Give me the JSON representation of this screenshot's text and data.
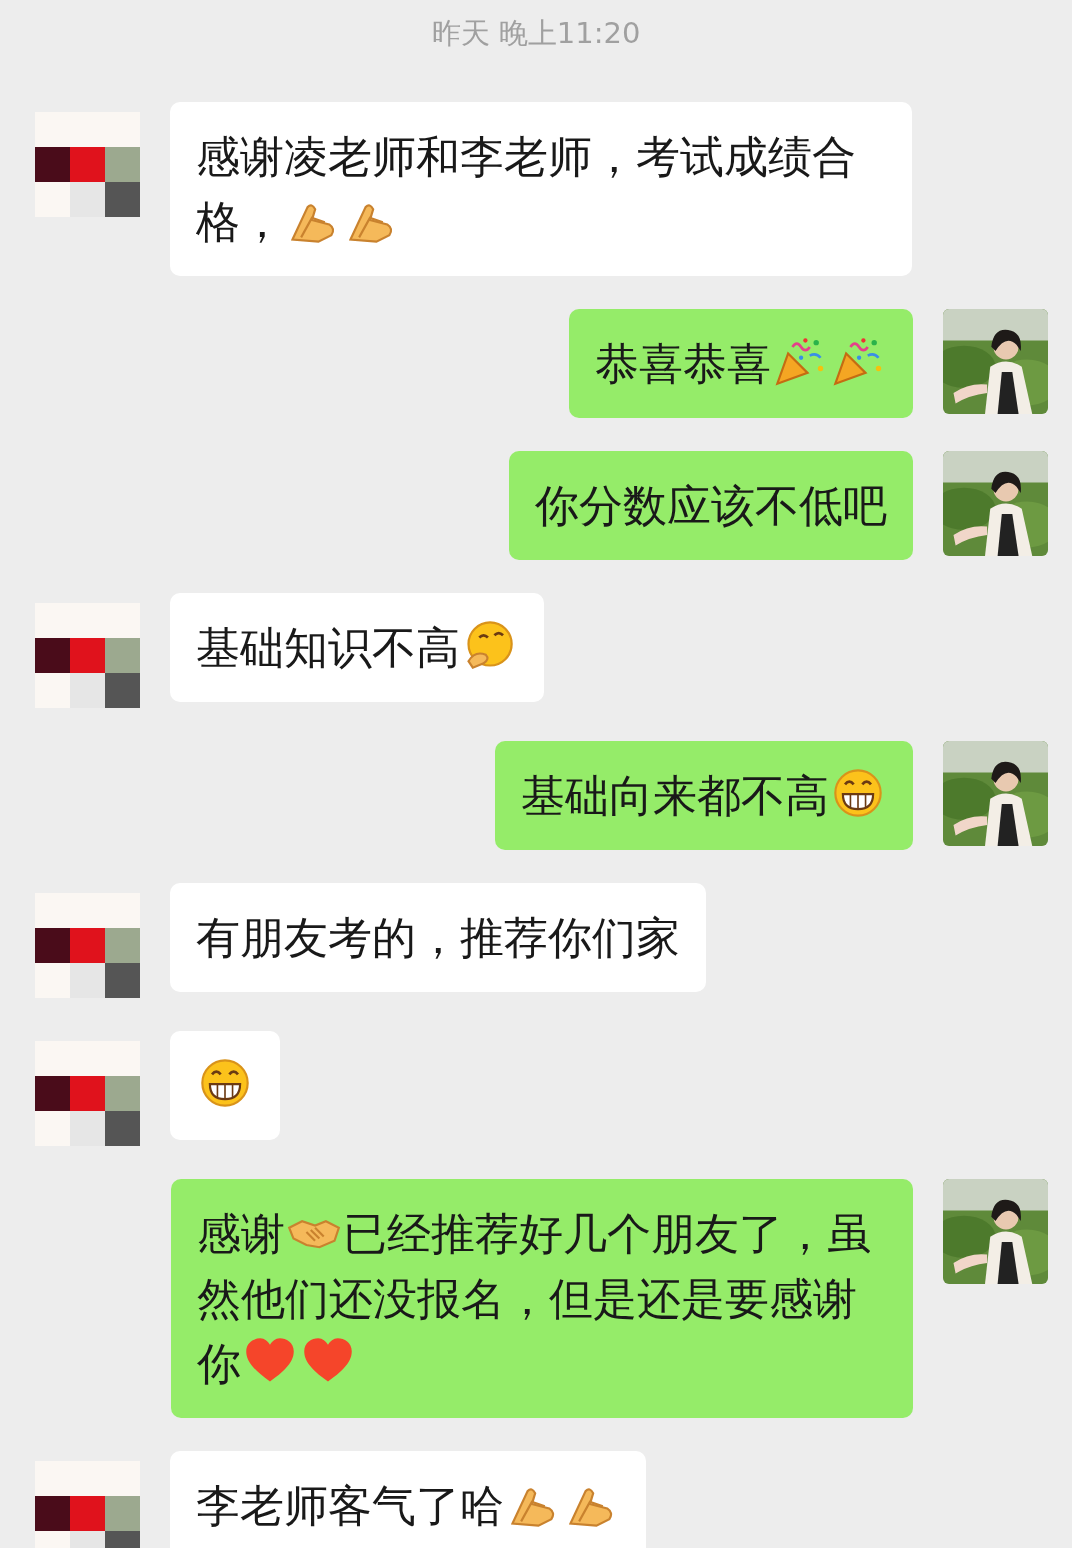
{
  "timestamp": "昨天 晚上11:20",
  "messages": [
    {
      "kind": "incoming",
      "parts": [
        {
          "kind": "text",
          "text": "感谢凌老师和李老师，考试成绩合格，"
        },
        {
          "kind": "hands"
        },
        {
          "kind": "hands"
        }
      ]
    },
    {
      "kind": "outgoing",
      "parts": [
        {
          "kind": "text",
          "text": "恭喜恭喜"
        },
        {
          "kind": "party"
        },
        {
          "kind": "party"
        }
      ]
    },
    {
      "kind": "outgoing",
      "parts": [
        {
          "kind": "text",
          "text": "你分数应该不低吧"
        }
      ]
    },
    {
      "kind": "incoming",
      "parts": [
        {
          "kind": "text",
          "text": "基础知识不高"
        },
        {
          "kind": "thinking"
        }
      ]
    },
    {
      "kind": "outgoing",
      "parts": [
        {
          "kind": "text",
          "text": "基础向来都不高"
        },
        {
          "kind": "grin"
        }
      ]
    },
    {
      "kind": "incoming",
      "parts": [
        {
          "kind": "text",
          "text": "有朋友考的，推荐你们家"
        }
      ]
    },
    {
      "kind": "incoming",
      "parts": [
        {
          "kind": "grin"
        }
      ]
    },
    {
      "kind": "outgoing",
      "parts": [
        {
          "kind": "text",
          "text": "感谢"
        },
        {
          "kind": "handshake"
        },
        {
          "kind": "text",
          "text": "已经推荐好几个朋友了，虽然他们还没报名，但是还是要感谢你"
        },
        {
          "kind": "heart"
        },
        {
          "kind": "heart"
        }
      ]
    },
    {
      "kind": "incoming",
      "parts": [
        {
          "kind": "text",
          "text": "李老师客气了哈"
        },
        {
          "kind": "hands"
        },
        {
          "kind": "hands"
        }
      ]
    }
  ]
}
